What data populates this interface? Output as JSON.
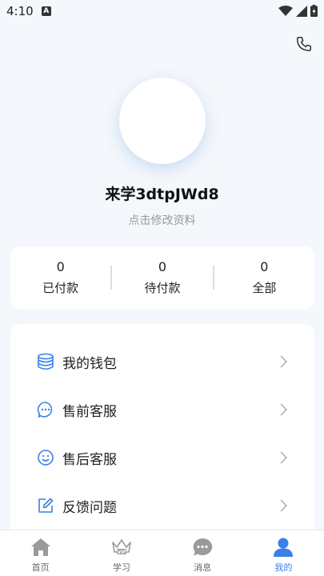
{
  "status_bar": {
    "time": "4:10",
    "notification_letter": "A"
  },
  "profile": {
    "username": "来学3dtpJWd8",
    "edit_link": "点击修改资料"
  },
  "orders": [
    {
      "count": "0",
      "label": "已付款"
    },
    {
      "count": "0",
      "label": "待付款"
    },
    {
      "count": "0",
      "label": "全部"
    }
  ],
  "menu": [
    {
      "label": "我的钱包",
      "icon": "wallet-icon"
    },
    {
      "label": "售前客服",
      "icon": "chat-bubble-icon"
    },
    {
      "label": "售后客服",
      "icon": "smiley-icon"
    },
    {
      "label": "反馈问题",
      "icon": "edit-icon"
    }
  ],
  "tabbar": [
    {
      "label": "首页",
      "icon": "home-icon",
      "active": false
    },
    {
      "label": "学习",
      "icon": "vip-crown-icon",
      "active": false
    },
    {
      "label": "消息",
      "icon": "message-icon",
      "active": false
    },
    {
      "label": "我的",
      "icon": "person-icon",
      "active": true
    }
  ],
  "colors": {
    "accent": "#3b7fe8",
    "background": "#f4f7fb",
    "card": "#ffffff",
    "icon_gray": "#9a9a9a"
  }
}
